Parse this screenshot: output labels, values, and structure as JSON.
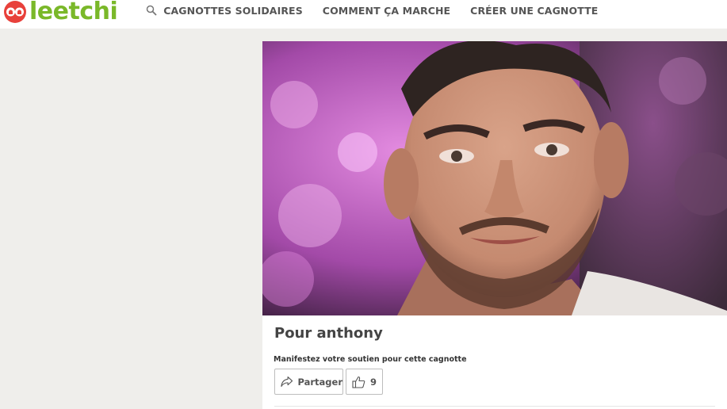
{
  "header": {
    "logo_text": "leetchi",
    "nav": [
      {
        "label": "CAGNOTTES SOLIDAIRES",
        "icon": "search-icon"
      },
      {
        "label": "COMMENT ÇA MARCHE"
      },
      {
        "label": "CRÉER UNE CAGNOTTE"
      }
    ]
  },
  "campaign": {
    "title": "Pour anthony",
    "support_text": "Manifestez votre soutien pour cette cagnotte",
    "share_label": "Partager",
    "like_count": "9"
  },
  "colors": {
    "brand_green": "#7ab829",
    "brand_red": "#e8413b",
    "background": "#efeeeb"
  }
}
